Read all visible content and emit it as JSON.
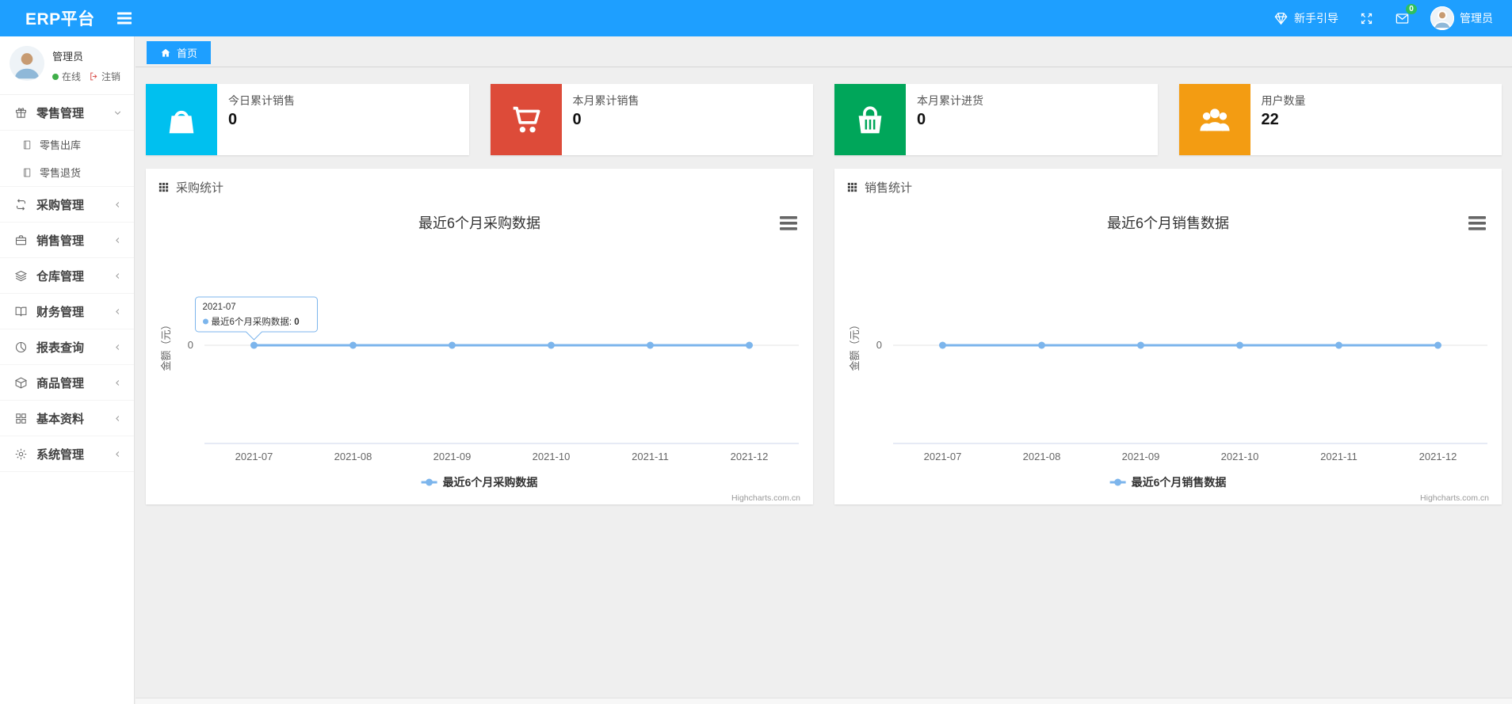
{
  "navbar": {
    "brand": "ERP平台",
    "guide_label": "新手引导",
    "mail_badge": "0",
    "user_name": "管理员"
  },
  "sidebar": {
    "user": {
      "name": "管理员",
      "status": "在线",
      "logout": "注销"
    },
    "menu": [
      {
        "icon": "gift",
        "label": "零售管理",
        "state": "expanded",
        "children": [
          {
            "icon": "book",
            "label": "零售出库"
          },
          {
            "icon": "book",
            "label": "零售退货"
          }
        ]
      },
      {
        "icon": "loop",
        "label": "采购管理",
        "state": "collapsed"
      },
      {
        "icon": "briefcase",
        "label": "销售管理",
        "state": "collapsed"
      },
      {
        "icon": "layers",
        "label": "仓库管理",
        "state": "collapsed"
      },
      {
        "icon": "bookopen",
        "label": "财务管理",
        "state": "collapsed"
      },
      {
        "icon": "pie",
        "label": "报表查询",
        "state": "collapsed"
      },
      {
        "icon": "box",
        "label": "商品管理",
        "state": "collapsed"
      },
      {
        "icon": "grid",
        "label": "基本资料",
        "state": "collapsed"
      },
      {
        "icon": "gear",
        "label": "系统管理",
        "state": "collapsed"
      }
    ]
  },
  "breadcrumb": {
    "home_label": "首页"
  },
  "stats": [
    {
      "icon": "bag",
      "color": "#00c0ef",
      "label": "今日累计销售",
      "value": "0"
    },
    {
      "icon": "cart",
      "color": "#dd4b39",
      "label": "本月累计销售",
      "value": "0"
    },
    {
      "icon": "basket",
      "color": "#00a65a",
      "label": "本月累计进货",
      "value": "0"
    },
    {
      "icon": "users",
      "color": "#f39c12",
      "label": "用户数量",
      "value": "22"
    }
  ],
  "panels": [
    {
      "header": "采购统计"
    },
    {
      "header": "销售统计"
    }
  ],
  "chart_data": [
    {
      "type": "line",
      "title": "最近6个月采购数据",
      "categories": [
        "2021-07",
        "2021-08",
        "2021-09",
        "2021-10",
        "2021-11",
        "2021-12"
      ],
      "series": [
        {
          "name": "最近6个月采购数据",
          "values": [
            0,
            0,
            0,
            0,
            0,
            0
          ]
        }
      ],
      "xlabel": "",
      "ylabel": "金额（元）",
      "yticks": [
        "0"
      ],
      "ylim": [
        0,
        0
      ],
      "grid": true,
      "legend_position": "bottom-center",
      "line_color": "#7cb5ec",
      "credits": "Highcharts.com.cn",
      "tooltip": {
        "header": "2021-07",
        "series": "最近6个月采购数据",
        "value": "0",
        "point_index": 0
      }
    },
    {
      "type": "line",
      "title": "最近6个月销售数据",
      "categories": [
        "2021-07",
        "2021-08",
        "2021-09",
        "2021-10",
        "2021-11",
        "2021-12"
      ],
      "series": [
        {
          "name": "最近6个月销售数据",
          "values": [
            0,
            0,
            0,
            0,
            0,
            0
          ]
        }
      ],
      "xlabel": "",
      "ylabel": "金额（元）",
      "yticks": [
        "0"
      ],
      "ylim": [
        0,
        0
      ],
      "grid": true,
      "legend_position": "bottom-center",
      "line_color": "#7cb5ec",
      "credits": "Highcharts.com.cn",
      "tooltip": null
    }
  ]
}
